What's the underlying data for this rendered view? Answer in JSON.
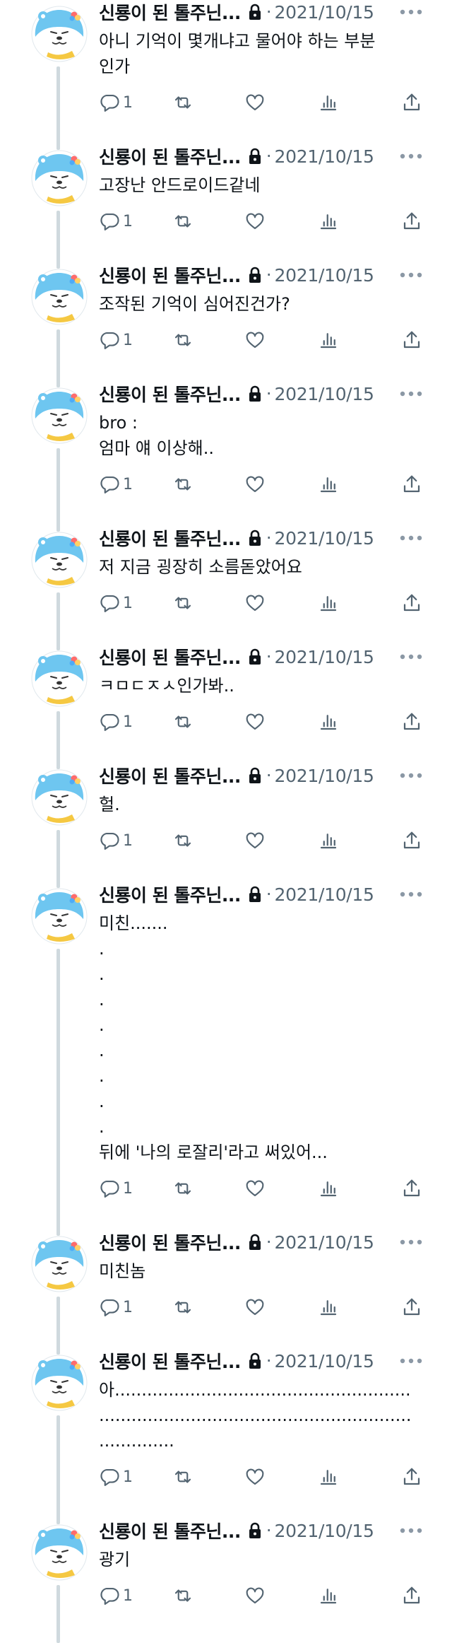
{
  "author": {
    "display_name": "신룡이 된 톨주닌...",
    "separator": "·",
    "protected_icon": "lock-icon",
    "avatar_icon": "otter-avatar"
  },
  "colors": {
    "text": "#0f1419",
    "muted": "#536471",
    "thread_line": "#cfd9de",
    "avatar_blue": "#6ec6f0"
  },
  "icons": {
    "reply": "reply-icon",
    "retweet": "retweet-icon",
    "like": "heart-icon",
    "views": "views-icon",
    "share": "share-icon",
    "more": "more-icon"
  },
  "tweets": [
    {
      "date": "2021/10/15",
      "lines": [
        "아니 기억이 몇개냐고 물어야 하는 부분",
        "인가"
      ],
      "reply_count": "1"
    },
    {
      "date": "2021/10/15",
      "lines": [
        "고장난 안드로이드같네"
      ],
      "reply_count": "1"
    },
    {
      "date": "2021/10/15",
      "lines": [
        "조작된 기억이 심어진건가?"
      ],
      "reply_count": "1"
    },
    {
      "date": "2021/10/15",
      "lines": [
        "bro :",
        "엄마 얘 이상해.."
      ],
      "reply_count": "1"
    },
    {
      "date": "2021/10/15",
      "lines": [
        "저 지금 굉장히 소름돋았어요"
      ],
      "reply_count": "1"
    },
    {
      "date": "2021/10/15",
      "lines": [
        "ㅋㅁㄷㅈㅅ인가봐.."
      ],
      "reply_count": "1"
    },
    {
      "date": "2021/10/15",
      "lines": [
        "헐."
      ],
      "reply_count": "1"
    },
    {
      "date": "2021/10/15",
      "lines": [
        "미친.......",
        ".",
        ".",
        ".",
        ".",
        ".",
        ".",
        ".",
        ".",
        "뒤에 '나의 로잘리'라고 써있어..."
      ],
      "reply_count": "1"
    },
    {
      "date": "2021/10/15",
      "lines": [
        "미친놈"
      ],
      "reply_count": "1"
    },
    {
      "date": "2021/10/15",
      "lines": [
        "아.......................................................",
        "..........................................................",
        ".............."
      ],
      "reply_count": "1"
    },
    {
      "date": "2021/10/15",
      "lines": [
        "광기"
      ],
      "reply_count": "1"
    }
  ]
}
